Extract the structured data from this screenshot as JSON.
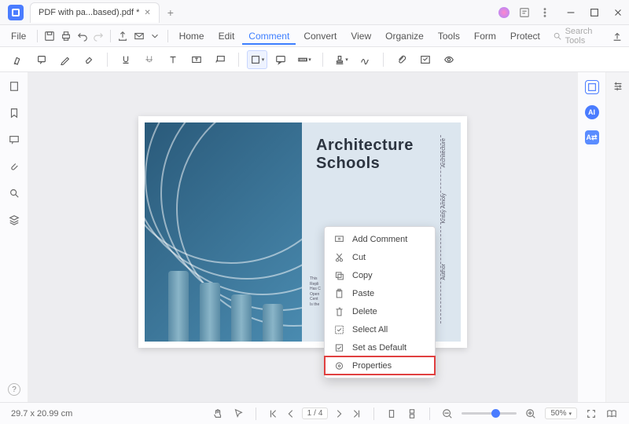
{
  "tab": {
    "title": "PDF with pa...based).pdf *"
  },
  "menubar": {
    "file": "File",
    "items": [
      "Home",
      "Edit",
      "Comment",
      "Convert",
      "View",
      "Organize",
      "Tools",
      "Form",
      "Protect"
    ],
    "active_index": 2,
    "search_placeholder": "Search Tools"
  },
  "document": {
    "title_line1": "Architecture",
    "title_line2": "Schools",
    "side_labels": [
      "Architecture",
      "Kristy Amoly",
      "Author"
    ],
    "body_snippet": "This\nRepli\nHas C\nOpen\nCent\nIs the"
  },
  "context_menu": {
    "items": [
      {
        "icon": "comment",
        "label": "Add Comment"
      },
      {
        "icon": "cut",
        "label": "Cut"
      },
      {
        "icon": "copy",
        "label": "Copy"
      },
      {
        "icon": "paste",
        "label": "Paste"
      },
      {
        "icon": "delete",
        "label": "Delete"
      },
      {
        "icon": "select-all",
        "label": "Select All"
      },
      {
        "icon": "default",
        "label": "Set as Default"
      },
      {
        "icon": "properties",
        "label": "Properties"
      }
    ],
    "highlighted_index": 7
  },
  "statusbar": {
    "dimensions": "29.7 x 20.99 cm",
    "page_current": "1",
    "page_total": "4",
    "zoom_pct": "50%"
  }
}
